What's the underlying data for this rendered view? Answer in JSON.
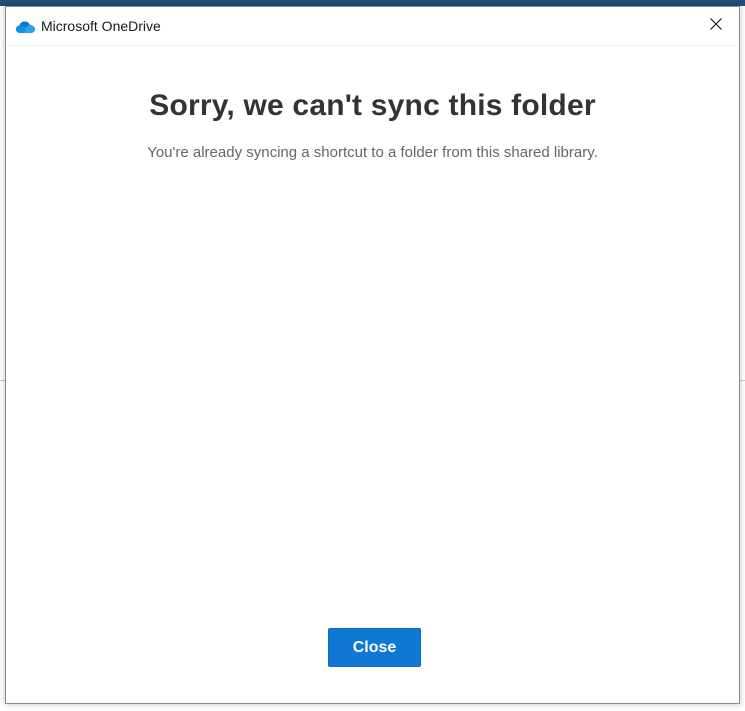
{
  "window": {
    "title": "Microsoft OneDrive",
    "title_icon": "onedrive-cloud-icon",
    "close_icon": "close-icon"
  },
  "dialog": {
    "heading": "Sorry, we can't sync this folder",
    "message": "You're already syncing a shortcut to a folder from this shared library.",
    "close_button_label": "Close"
  },
  "colors": {
    "accent": "#0f78d4",
    "heading_text": "#333333",
    "body_text": "#666666",
    "onedrive_blue": "#0364b8"
  }
}
